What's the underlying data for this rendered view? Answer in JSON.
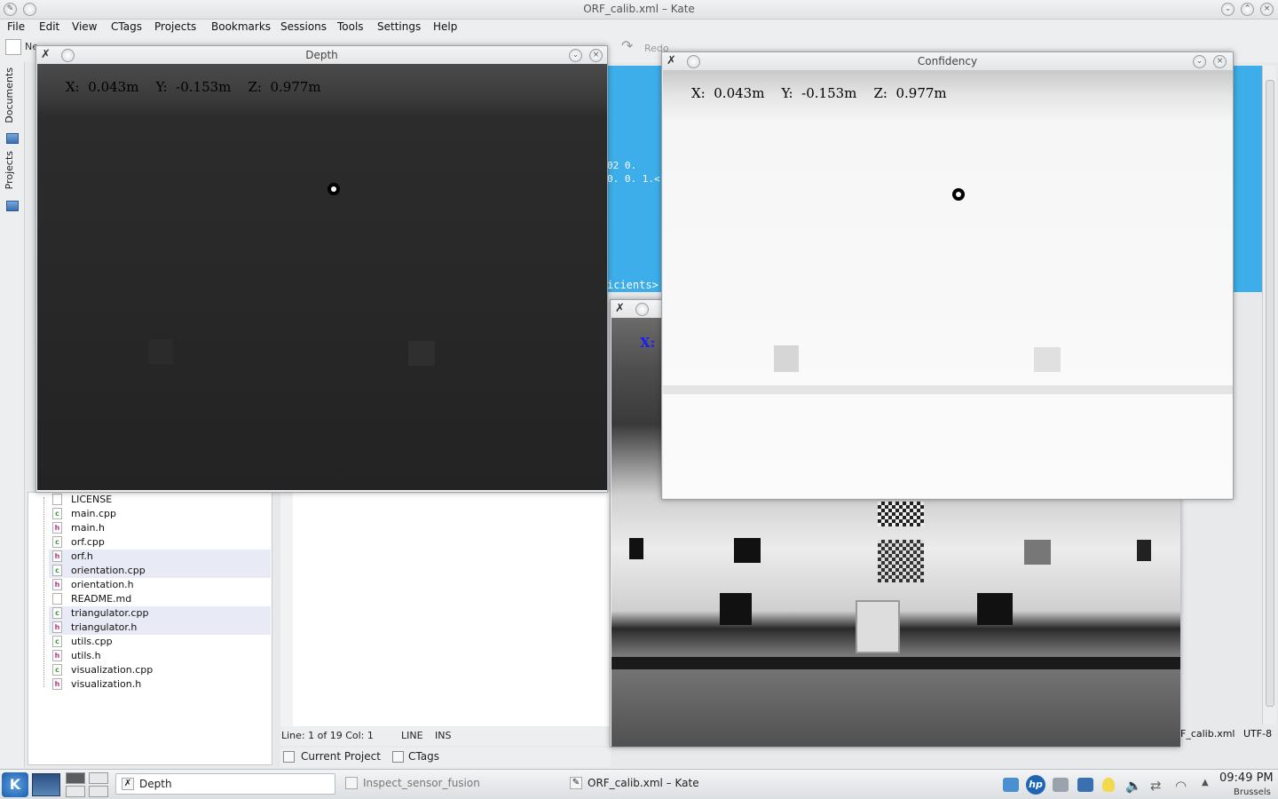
{
  "kate": {
    "window_title": "ORF_calib.xml – Kate",
    "menu": [
      "File",
      "Edit",
      "View",
      "CTags",
      "Projects",
      "Bookmarks",
      "Sessions",
      "Tools",
      "Settings",
      "Help"
    ],
    "toolbar": {
      "new_label": "Ne",
      "redo_label": "Redo"
    },
    "side_tabs": {
      "documents": "Documents",
      "projects": "Projects"
    },
    "files": [
      {
        "name": "LICENSE",
        "type": "doc",
        "selected": false
      },
      {
        "name": "main.cpp",
        "type": "cpp",
        "selected": false
      },
      {
        "name": "main.h",
        "type": "h",
        "selected": false
      },
      {
        "name": "orf.cpp",
        "type": "cpp",
        "selected": false
      },
      {
        "name": "orf.h",
        "type": "h",
        "selected": true
      },
      {
        "name": "orientation.cpp",
        "type": "cpp",
        "selected": true
      },
      {
        "name": "orientation.h",
        "type": "h",
        "selected": false
      },
      {
        "name": "README.md",
        "type": "doc",
        "selected": false
      },
      {
        "name": "triangulator.cpp",
        "type": "cpp",
        "selected": true
      },
      {
        "name": "triangulator.h",
        "type": "h",
        "selected": true
      },
      {
        "name": "utils.cpp",
        "type": "cpp",
        "selected": false
      },
      {
        "name": "utils.h",
        "type": "h",
        "selected": false
      },
      {
        "name": "visualization.cpp",
        "type": "cpp",
        "selected": false
      },
      {
        "name": "visualization.h",
        "type": "h",
        "selected": false
      }
    ],
    "editor_fragments": {
      "line1": "02 0.",
      "line2": "0. 0. 1.<",
      "line3": "icients>"
    },
    "status": {
      "position": "Line: 1 of 19 Col: 1",
      "mode": "LINE",
      "insert": "INS",
      "filename": "F_calib.xml",
      "encoding": "UTF-8"
    },
    "bottom_tabs": {
      "current_project": "Current Project",
      "ctags": "CTags"
    }
  },
  "windows": {
    "depth": {
      "title": "Depth",
      "readout": "X:  0.043m    Y:  -0.153m    Z:  0.977m"
    },
    "confidence": {
      "title": "Confidency",
      "readout": "X:  0.043m    Y:  -0.153m    Z:  0.977m"
    },
    "third": {
      "readout_fragment": "X:"
    }
  },
  "taskbar": {
    "tasks": [
      {
        "label": "Depth",
        "active": true
      },
      {
        "label": "Inspect_sensor_fusion",
        "active": false
      },
      {
        "label": "ORF_calib.xml – Kate",
        "active": false
      }
    ],
    "clock": "09:49 PM",
    "location": "Brussels"
  },
  "colors": {
    "accent_blue": "#3daee9",
    "depth_bg": "#262626",
    "confidence_bg": "#f7f7f7",
    "readout_blue": "#1a1aff"
  }
}
